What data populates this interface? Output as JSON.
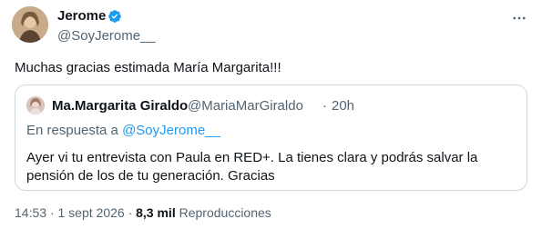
{
  "tweet": {
    "author_name": "Jerome",
    "author_handle": "@SoyJerome__",
    "verified": true,
    "text": "Muchas gracias estimada María Margarita!!!",
    "more_icon": "more-horizontal-icon",
    "time": "14:53",
    "separator": "·",
    "date": "1 sept 2026",
    "views_count": "8,3 mil",
    "views_label": "Reproducciones"
  },
  "quoted": {
    "author_name": "Ma.Margarita Giraldo",
    "author_handle": "@MariaMarGiraldo",
    "separator": "·",
    "time": "20h",
    "reply_prefix": "En respuesta a",
    "reply_to": "@SoyJerome__",
    "text": "Ayer vi tu entrevista con Paula en RED+. La tienes clara y podrás salvar la pensión de los de tu generación. Gracias"
  },
  "colors": {
    "link": "#1d9bf0",
    "secondary_text": "#536471",
    "border": "#cfd9de",
    "verified_badge": "#1d9bf0"
  }
}
